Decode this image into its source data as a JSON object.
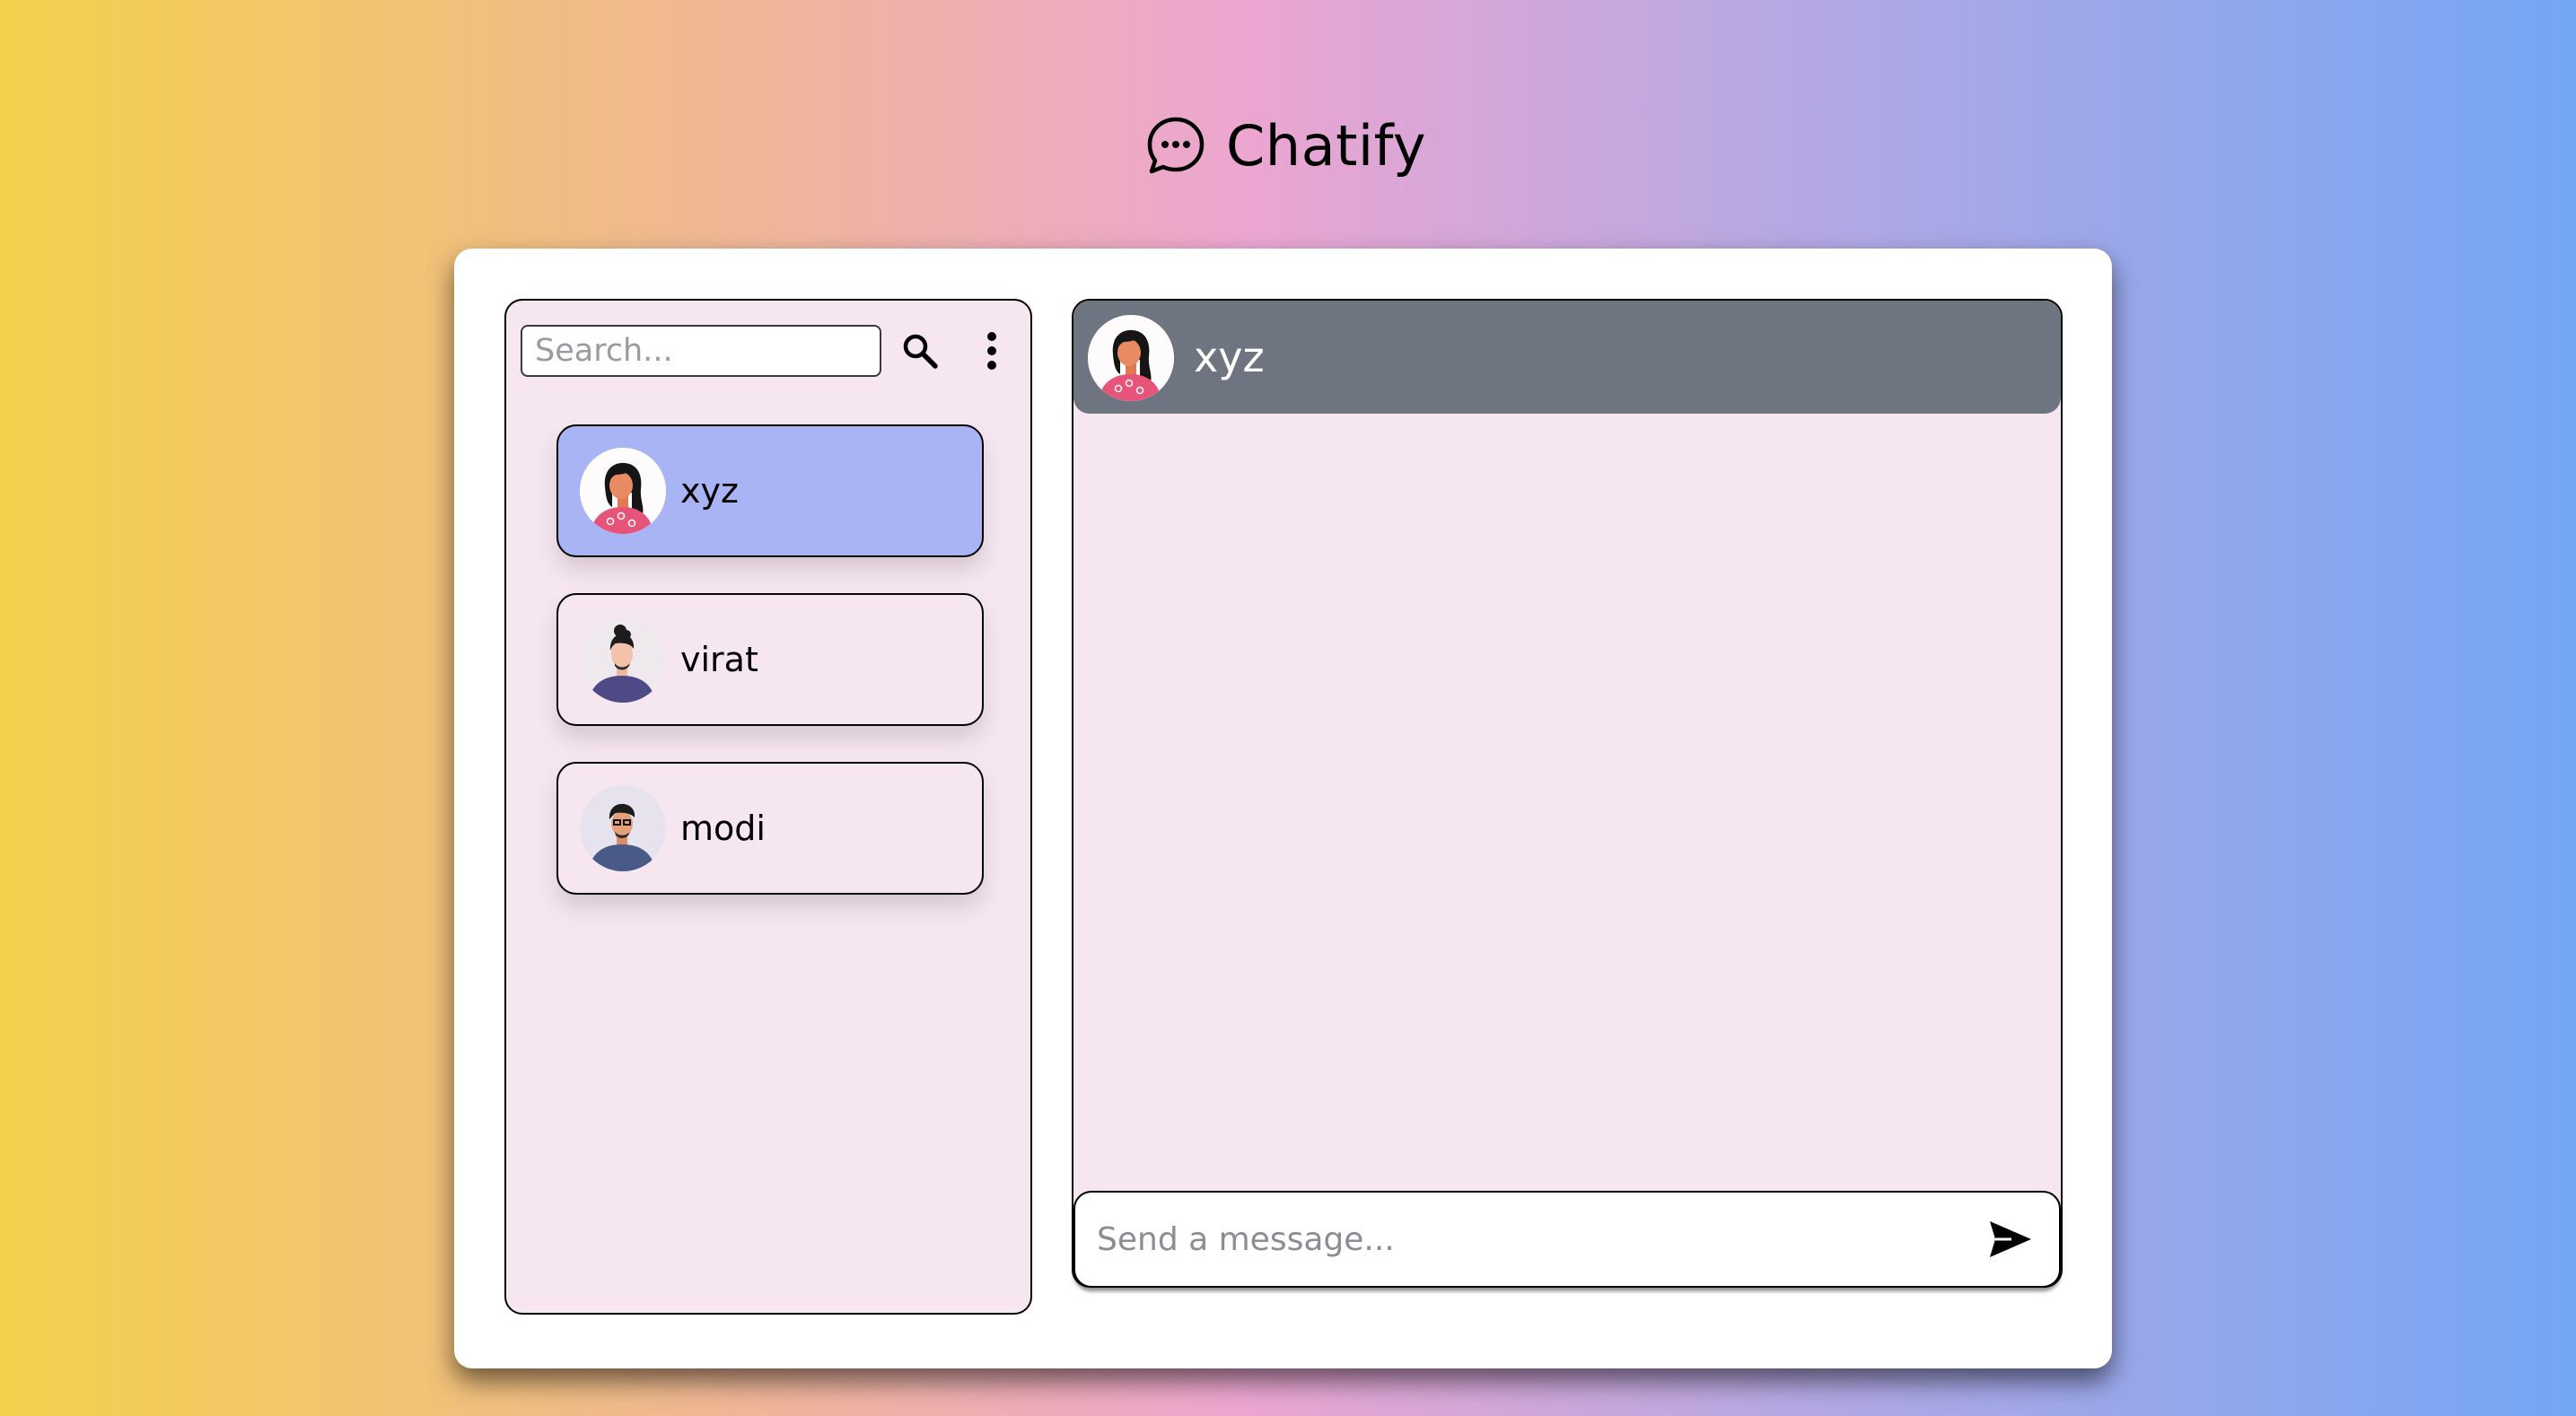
{
  "app": {
    "title": "Chatify",
    "logo_icon": "chat-bubble-icon"
  },
  "colors": {
    "background_gradient": [
      "#f3d14c",
      "#eca6d0",
      "#74a6f4"
    ],
    "active_contact": "#a9b4f4",
    "panel": "#f6e6f0",
    "chat_header": "#6e7581"
  },
  "sidebar": {
    "search": {
      "placeholder": "Search...",
      "value": ""
    },
    "search_icon": "search-icon",
    "menu_icon": "kebab-menu-icon",
    "contacts": [
      {
        "name": "xyz",
        "active": true
      },
      {
        "name": "virat",
        "active": false
      },
      {
        "name": "modi",
        "active": false
      }
    ]
  },
  "chat": {
    "contact_name": "xyz",
    "messages": [],
    "composer": {
      "placeholder": "Send a message...",
      "value": ""
    },
    "send_icon": "send-icon"
  }
}
